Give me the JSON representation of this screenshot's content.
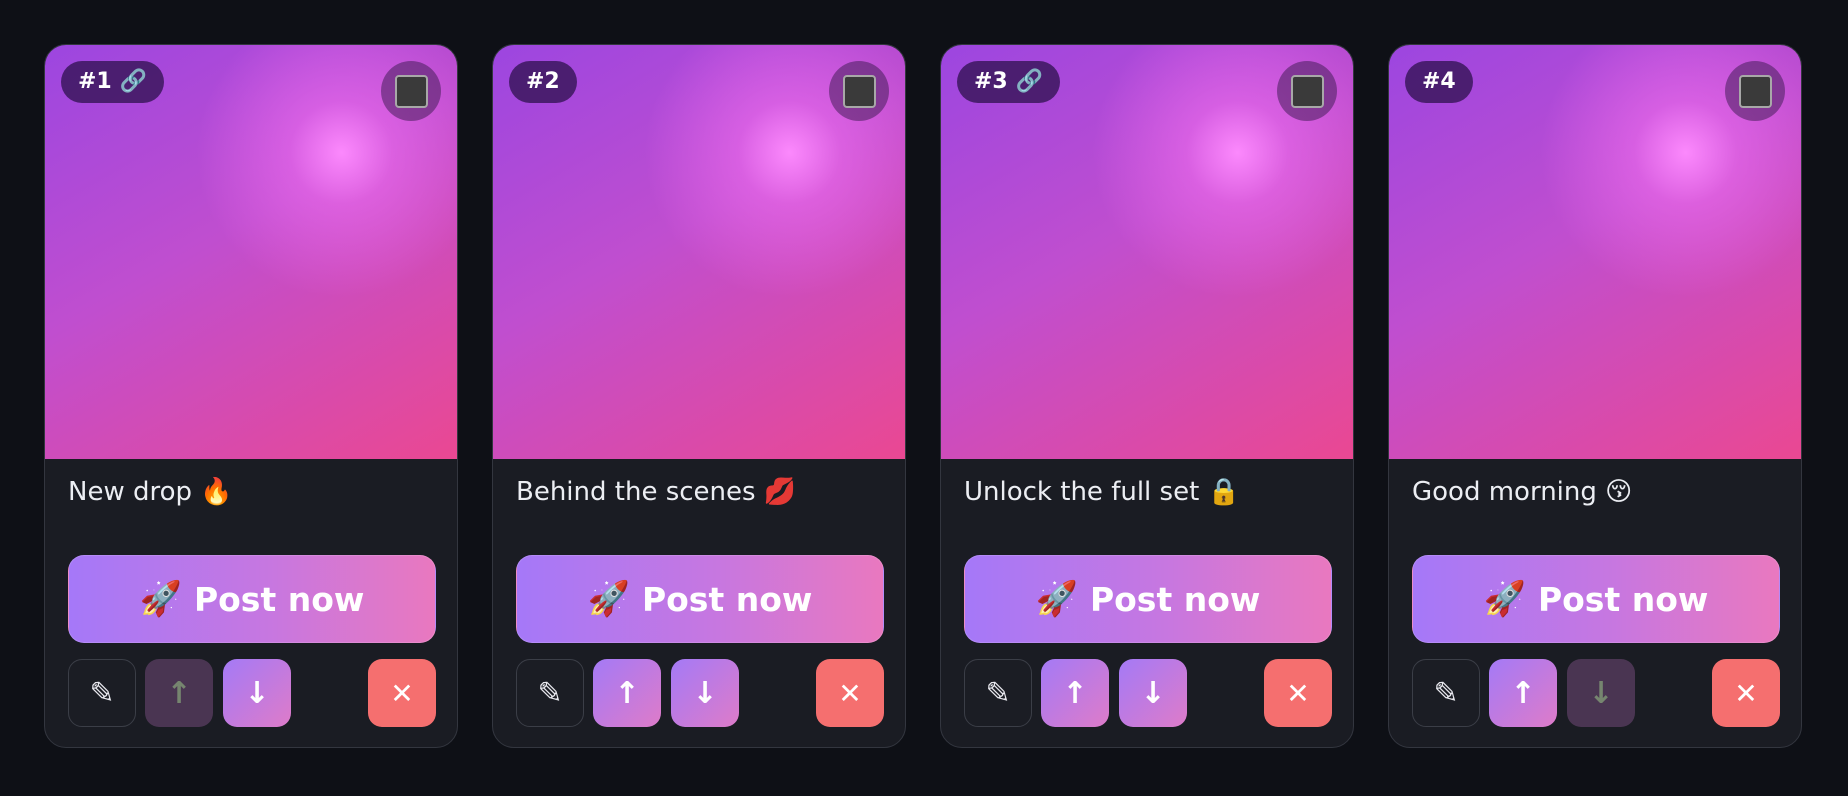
{
  "colors": {
    "page_background": "#0e1016",
    "card_background": "#1a1c23",
    "post_button_gradient": [
      "#a578f8",
      "#e978bf"
    ],
    "delete_button": "#f56f6f",
    "thumbnail_gradient": [
      "#9c46e0",
      "#ea4892"
    ]
  },
  "cards": [
    {
      "badge_number": "#1",
      "has_link": true,
      "link_icon": "🔗",
      "caption": "New drop 🔥",
      "selected": false,
      "post_label": "Post now",
      "rocket_icon": "🚀",
      "edit_icon": "✎",
      "up_icon": "↑",
      "down_icon": "↓",
      "delete_icon": "✕",
      "can_move_up": false,
      "can_move_down": true
    },
    {
      "badge_number": "#2",
      "has_link": false,
      "link_icon": "",
      "caption": "Behind the scenes 💋",
      "selected": false,
      "post_label": "Post now",
      "rocket_icon": "🚀",
      "edit_icon": "✎",
      "up_icon": "↑",
      "down_icon": "↓",
      "delete_icon": "✕",
      "can_move_up": true,
      "can_move_down": true
    },
    {
      "badge_number": "#3",
      "has_link": true,
      "link_icon": "🔗",
      "caption": "Unlock the full set 🔒",
      "selected": false,
      "post_label": "Post now",
      "rocket_icon": "🚀",
      "edit_icon": "✎",
      "up_icon": "↑",
      "down_icon": "↓",
      "delete_icon": "✕",
      "can_move_up": true,
      "can_move_down": true
    },
    {
      "badge_number": "#4",
      "has_link": false,
      "link_icon": "",
      "caption": "Good morning 😚",
      "selected": false,
      "post_label": "Post now",
      "rocket_icon": "🚀",
      "edit_icon": "✎",
      "up_icon": "↑",
      "down_icon": "↓",
      "delete_icon": "✕",
      "can_move_up": true,
      "can_move_down": false
    }
  ]
}
